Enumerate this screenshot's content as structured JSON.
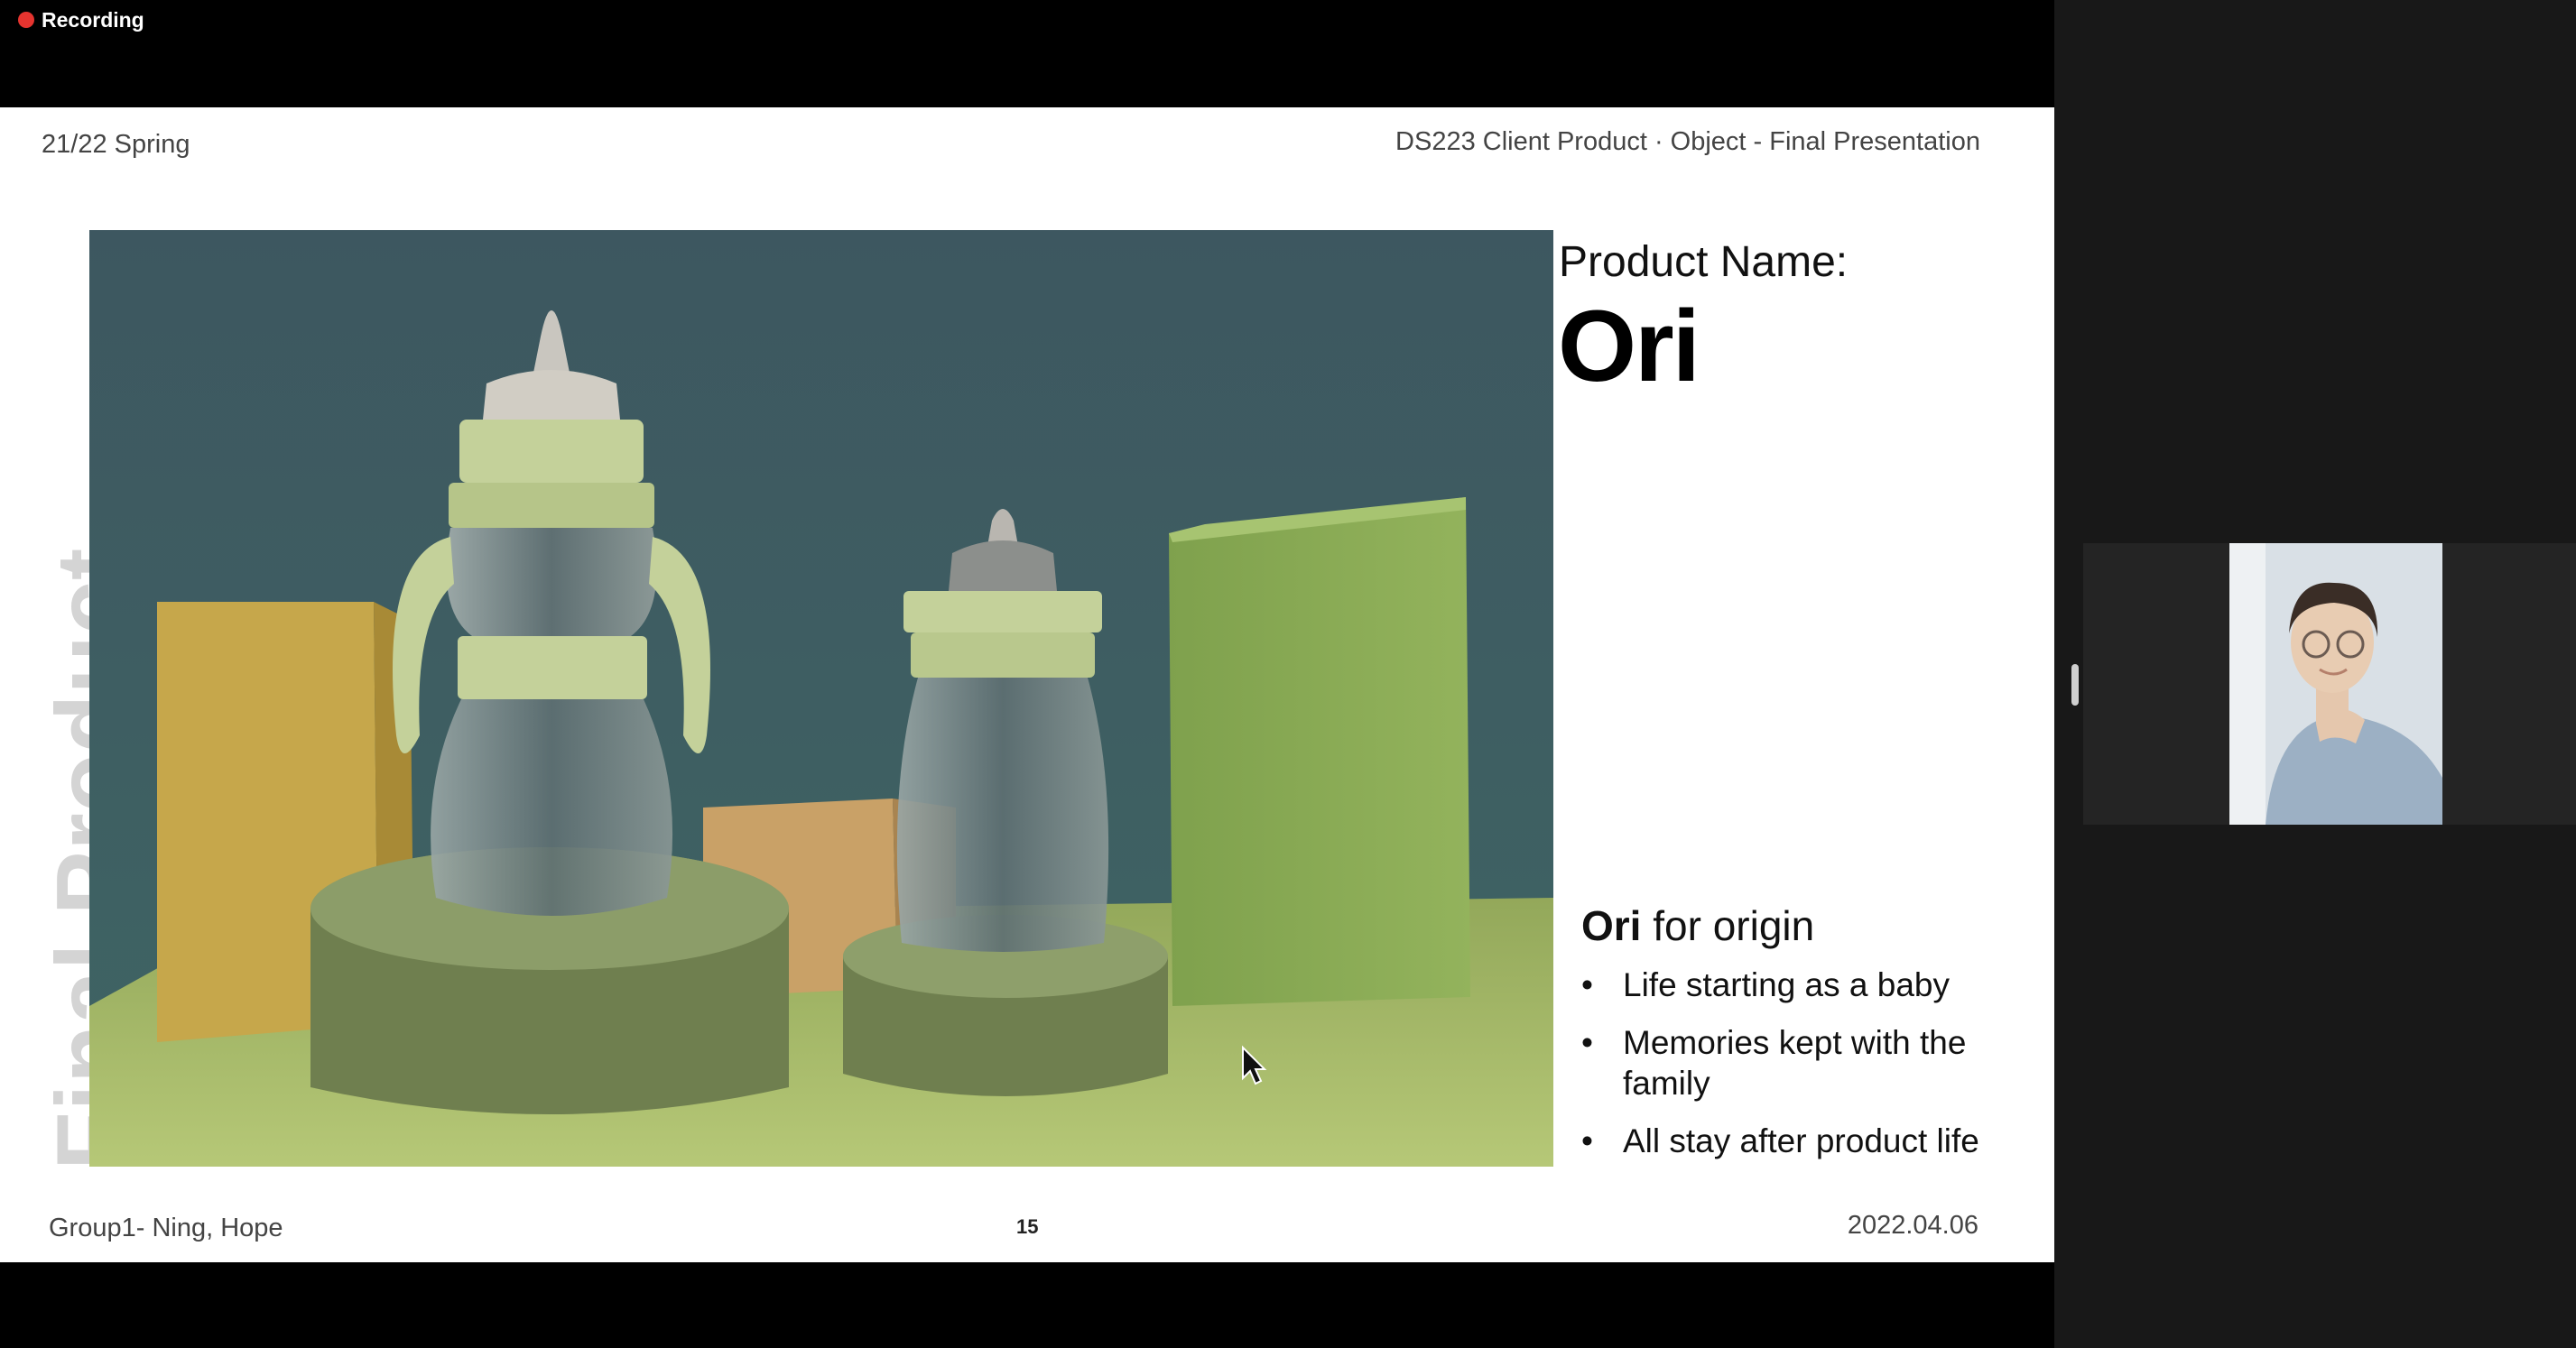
{
  "recording": {
    "label": "Recording"
  },
  "slide": {
    "header_left": "21/22 Spring",
    "header_right": "DS223 Client Product · Object - Final Presentation",
    "vertical_title": "Final Product",
    "product_name_label": "Product Name:",
    "product_name": "Ori",
    "origin_bold": "Ori",
    "origin_rest": " for origin",
    "bullets": [
      "Life starting as a baby",
      "Memories kept with the family",
      "All stay after product life"
    ],
    "footer_left": "Group1- Ning, Hope",
    "page_number": "15",
    "footer_right": "2022.04.06"
  },
  "colors": {
    "recording_dot": "#e5342f",
    "slide_background": "#ffffff",
    "panel_background": "#181818"
  },
  "icons": [
    "recording-dot-icon",
    "mouse-cursor-icon"
  ]
}
